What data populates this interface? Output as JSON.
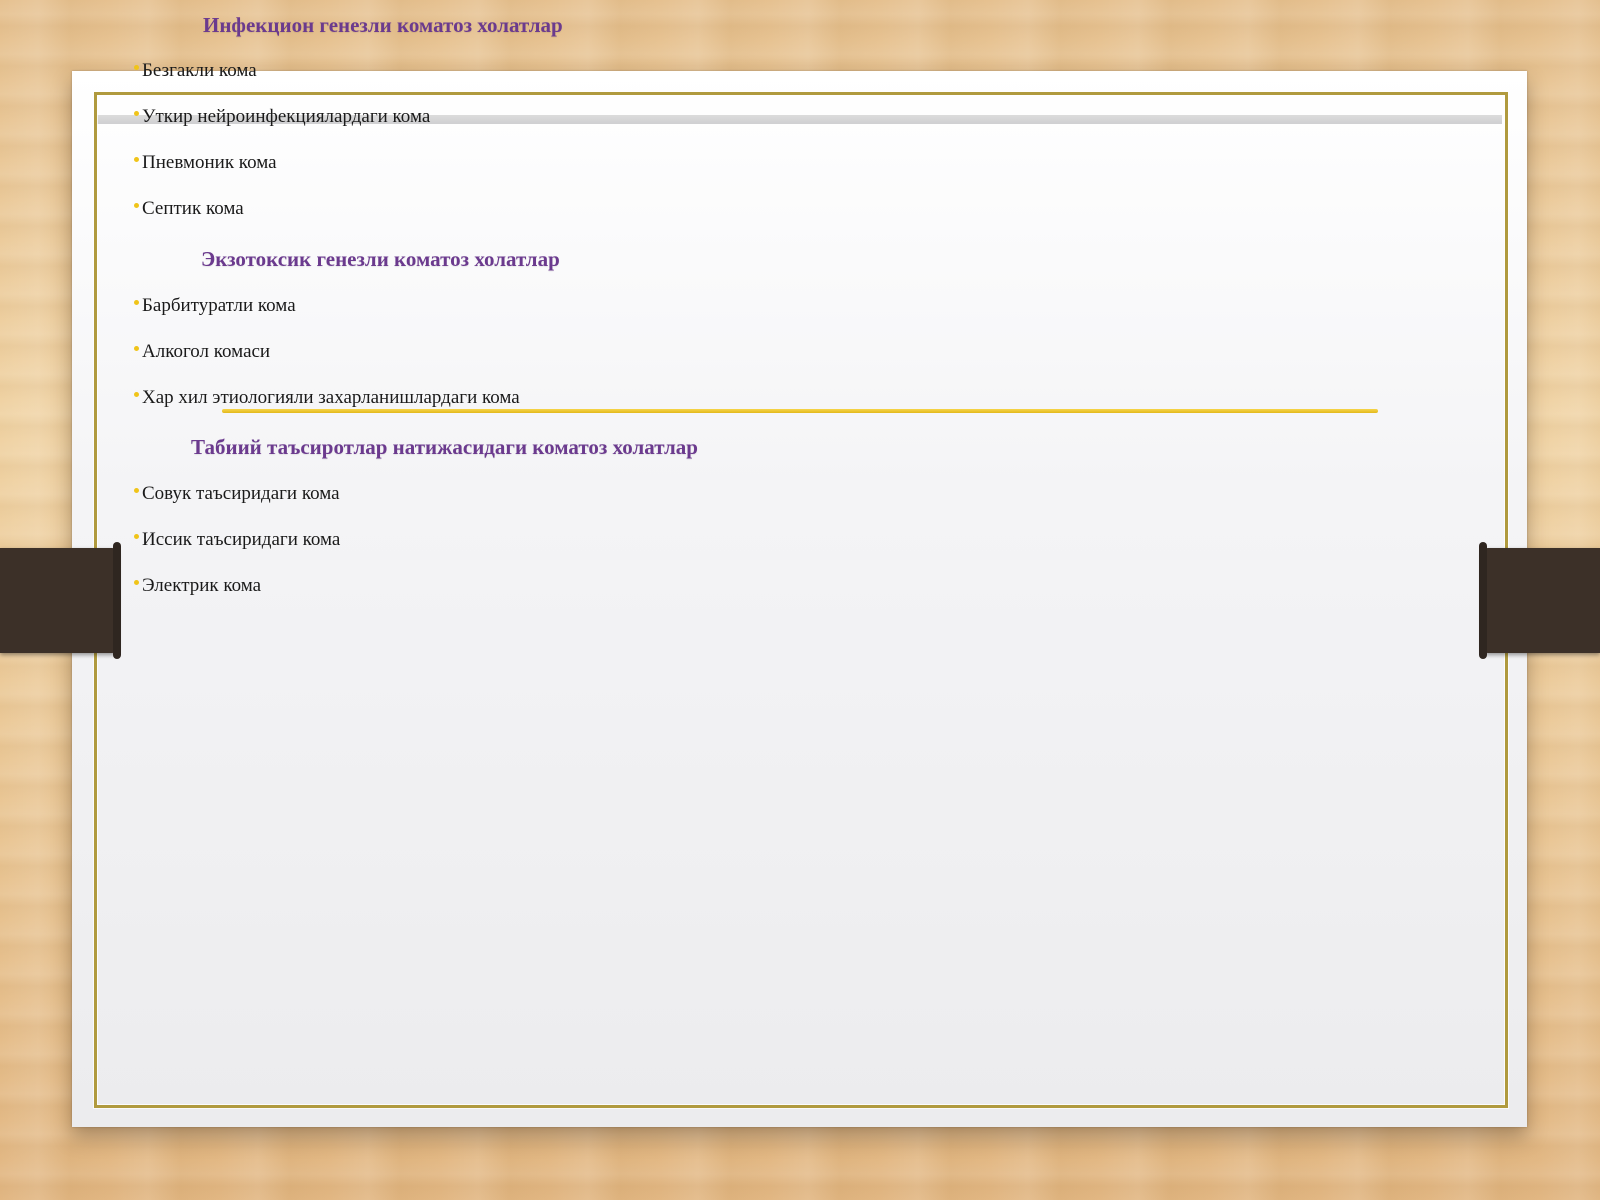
{
  "sections": [
    {
      "heading": "Инфекцион генезли коматоз холатлар",
      "items": [
        "Безгакли кома",
        "Уткир нейроинфекциялардаги кома",
        "Пневмоник кома",
        "Септик кома"
      ]
    },
    {
      "heading": "Экзотоксик генезли коматоз холатлар",
      "items": [
        "Барбитуратли кома",
        "Алкогол комаси",
        "Хар хил этиологияли захарланишлардаги кома"
      ]
    },
    {
      "heading": "Табиий таъсиротлар натижасидаги коматоз холатлар",
      "items": [
        "Совук таъсиридаги кома",
        "Иссик таъсиридаги кома",
        "Электрик кома"
      ]
    }
  ],
  "colors": {
    "heading": "#6b3a8e",
    "bullet": "#f0c419",
    "frame": "#b09a3e",
    "clip": "#3c3028"
  }
}
